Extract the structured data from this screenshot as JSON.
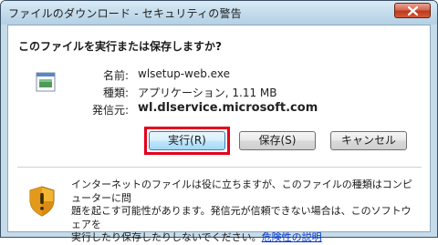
{
  "window": {
    "title": "ファイルのダウンロード - セキュリティの警告"
  },
  "question": "このファイルを実行または保存しますか?",
  "file": {
    "name_label": "名前:",
    "name": "wlsetup-web.exe",
    "type_label": "種類:",
    "type": "アプリケーション, 1.11 MB",
    "from_label": "発信元:",
    "from": "wl.dlservice.microsoft.com"
  },
  "buttons": {
    "run": "実行(R)",
    "save": "保存(S)",
    "cancel": "キャンセル"
  },
  "warning": {
    "line1": "インターネットのファイルは役に立ちますが、このファイルの種類はコンピューターに問",
    "line2": "題を起こす可能性があります。発信元が信頼できない場合は、このソフトウェアを",
    "line3": "実行したり保存したりしないでください。",
    "link": "危険性の説明"
  },
  "colors": {
    "highlight": "#e3001b",
    "link": "#0033cc"
  }
}
